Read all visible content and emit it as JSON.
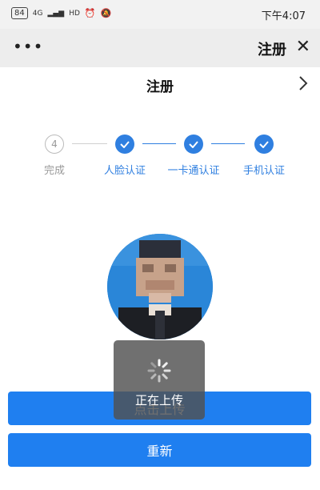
{
  "status_bar": {
    "time": "下午4:07",
    "battery": "84",
    "network": "4G",
    "hd": "HD",
    "colors": {
      "background": "#f2f2f2"
    }
  },
  "top_bar": {
    "title": "注册",
    "more_icon": "more-dots-icon",
    "close_icon": "close-icon",
    "colors": {
      "background": "#ededed"
    }
  },
  "page": {
    "title": "注册",
    "back_icon": "chevron-icon"
  },
  "steps": [
    {
      "label": "手机认证",
      "done": true
    },
    {
      "label": "一卡通认证",
      "done": true
    },
    {
      "label": "人脸认证",
      "done": true
    },
    {
      "label": "完成",
      "done": false,
      "number": "4"
    }
  ],
  "upload": {
    "button_label": "点击上传",
    "retry_label": "重新",
    "toast_text": "正在上传"
  },
  "colors": {
    "accent": "#1f7ff0",
    "step_done": "#2f7fe0",
    "step_todo": "#999999"
  }
}
